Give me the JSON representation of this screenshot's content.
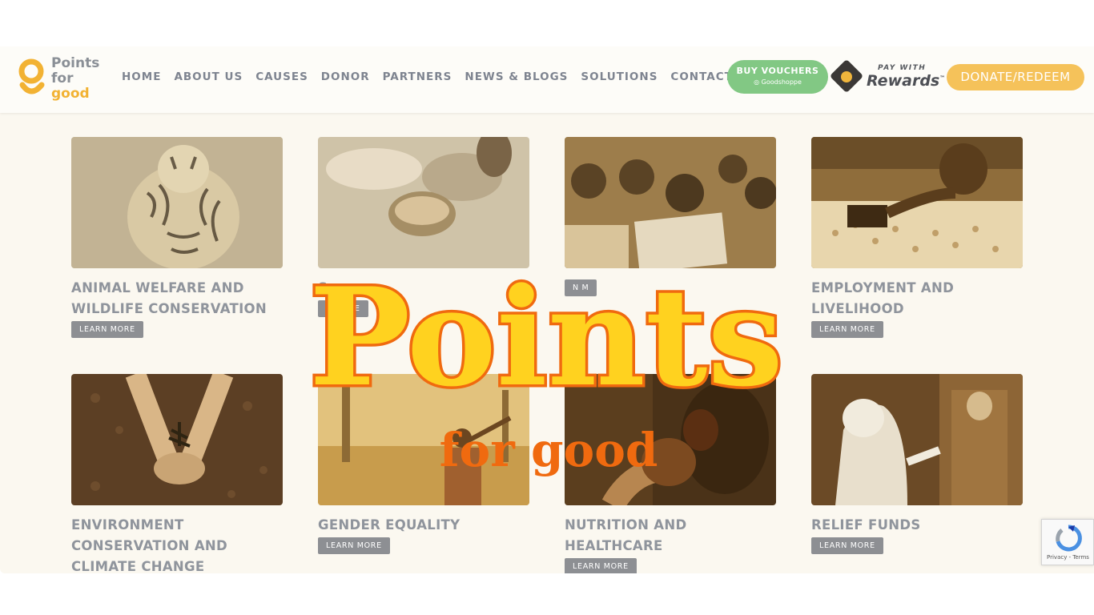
{
  "logo": {
    "line1": "Points",
    "line2": "for",
    "line3": "good"
  },
  "nav": [
    "HOME",
    "ABOUT US",
    "CAUSES",
    "DONOR",
    "PARTNERS",
    "NEWS & BLOGS",
    "SOLUTIONS",
    "CONTACT US"
  ],
  "buttons": {
    "vouchers_label": "BUY VOUCHERS",
    "vouchers_sub": "◎ Goodshoppe",
    "pay_with": "PAY WITH",
    "rewards": "Rewards",
    "rewards_tm": "™",
    "donate": "DONATE/REDEEM"
  },
  "cards": [
    {
      "title": "ANIMAL WELFARE AND WILDLIFE CONSERVATION",
      "cta": "LEARN MORE"
    },
    {
      "title": "S",
      "cta": "N MORE"
    },
    {
      "title": "",
      "cta": "N M"
    },
    {
      "title": "EMPLOYMENT AND LIVELIHOOD",
      "cta": "LEARN MORE"
    },
    {
      "title": "ENVIRONMENT CONSERVATION AND CLIMATE CHANGE",
      "cta": ""
    },
    {
      "title": "GENDER EQUALITY",
      "cta": "LEARN MORE"
    },
    {
      "title": "NUTRITION AND HEALTHCARE",
      "cta": "LEARN MORE"
    },
    {
      "title": "RELIEF FUNDS",
      "cta": "LEARN MORE"
    }
  ],
  "overlay": {
    "big": "Points",
    "small": "for good"
  },
  "recaptcha": {
    "links": "Privacy - Terms"
  },
  "colors": {
    "brand_yellow": "#f2b233",
    "voucher_green": "#82c884",
    "donate_orange": "#f5c25a",
    "overlay_fill": "#ffd21f",
    "overlay_stroke": "#f06a0f"
  }
}
